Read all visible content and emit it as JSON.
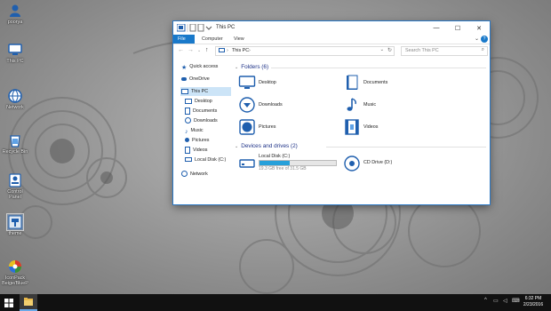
{
  "desktop": {
    "icons": [
      {
        "label": "poorya",
        "icon": "user-folder-icon"
      },
      {
        "label": "This PC",
        "icon": "computer-icon"
      },
      {
        "label": "Network",
        "icon": "network-icon"
      },
      {
        "label": "Recycle Bin",
        "icon": "recycle-bin-icon"
      },
      {
        "label": "Control Panel",
        "icon": "control-panel-icon"
      },
      {
        "label": "theme",
        "icon": "theme-icon"
      },
      {
        "label": "IconPack Beige/BlueP",
        "icon": "iconpack-icon"
      }
    ]
  },
  "window": {
    "title": "This PC",
    "ribbon_tabs": [
      "File",
      "Computer",
      "View"
    ],
    "help": "?",
    "address": {
      "path": "This PC",
      "sep": "›"
    },
    "search_placeholder": "Search This PC",
    "nav_items": [
      {
        "label": "Quick access",
        "icon": "star-icon"
      },
      {
        "label": "OneDrive",
        "icon": "cloud-icon"
      },
      {
        "label": "This PC",
        "icon": "computer-icon"
      },
      {
        "label": "Desktop",
        "icon": "desktop-icon"
      },
      {
        "label": "Documents",
        "icon": "documents-icon"
      },
      {
        "label": "Downloads",
        "icon": "downloads-icon"
      },
      {
        "label": "Music",
        "icon": "music-icon"
      },
      {
        "label": "Pictures",
        "icon": "pictures-icon"
      },
      {
        "label": "Videos",
        "icon": "videos-icon"
      },
      {
        "label": "Local Disk (C:)",
        "icon": "drive-icon"
      },
      {
        "label": "Network",
        "icon": "network-icon"
      }
    ],
    "folders_header": "Folders (6)",
    "folders": [
      {
        "label": "Desktop",
        "icon": "desktop-icon"
      },
      {
        "label": "Documents",
        "icon": "documents-icon"
      },
      {
        "label": "Downloads",
        "icon": "downloads-icon"
      },
      {
        "label": "Music",
        "icon": "music-icon"
      },
      {
        "label": "Pictures",
        "icon": "pictures-icon"
      },
      {
        "label": "Videos",
        "icon": "videos-icon"
      }
    ],
    "drives_header": "Devices and drives (2)",
    "drives": [
      {
        "label": "Local Disk (C:)",
        "free": "19.3 GB free of 31.5 GB",
        "used_fraction": 0.39,
        "icon": "drive-icon"
      },
      {
        "label": "CD Drive (D:)",
        "icon": "cd-drive-icon"
      }
    ]
  },
  "taskbar": {
    "clock_time": "6:32 PM",
    "clock_date": "2/23/2016"
  },
  "colors": {
    "accent": "#1979ca",
    "icon_blue": "#1f5fae",
    "folder_header": "#1e3287"
  }
}
